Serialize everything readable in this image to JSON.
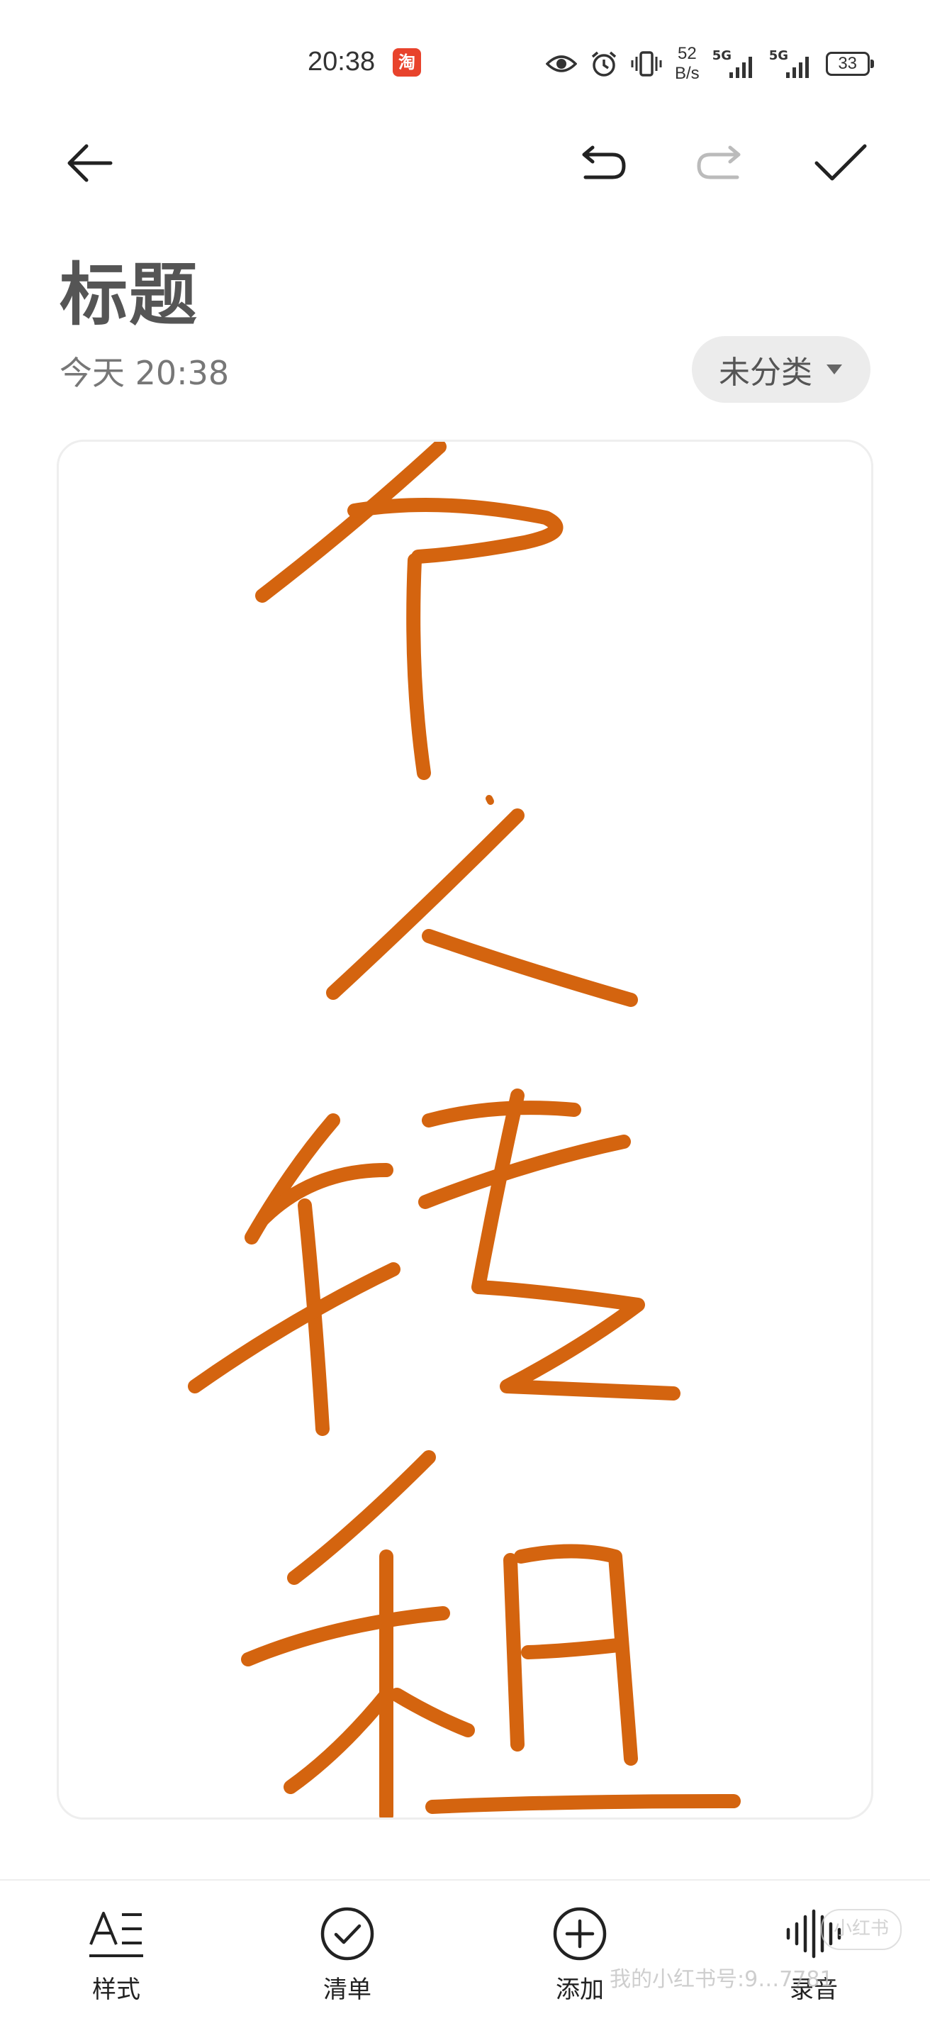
{
  "status_bar": {
    "time": "20:38",
    "app_badge": "淘",
    "net_speed_value": "52",
    "net_speed_unit": "B/s",
    "signal_label_1": "5G",
    "signal_label_2": "5G",
    "battery": "33"
  },
  "note": {
    "title": "标题",
    "date": "今天 20:38",
    "category": "未分类",
    "ink_color": "#d4640f"
  },
  "bottom_bar": {
    "items": [
      {
        "label": "样式",
        "icon": "text-style-icon"
      },
      {
        "label": "清单",
        "icon": "checklist-icon"
      },
      {
        "label": "添加",
        "icon": "add-circle-icon"
      },
      {
        "label": "录音",
        "icon": "audio-wave-icon"
      }
    ]
  },
  "watermark": {
    "text": "我的小红书号:9…7781",
    "badge": "小红书"
  }
}
